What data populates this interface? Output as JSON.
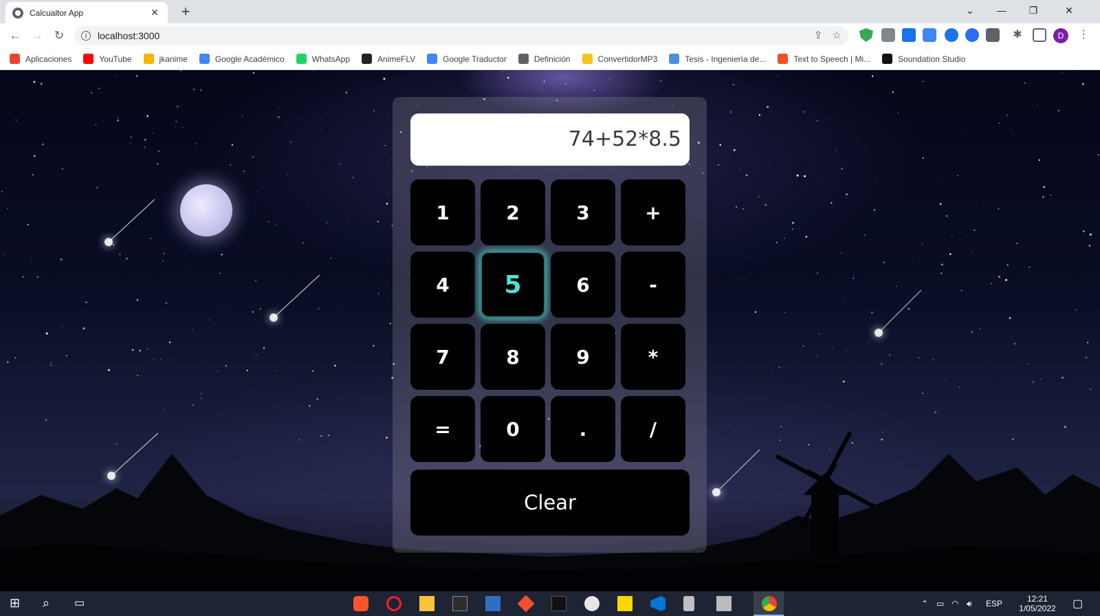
{
  "browser": {
    "tab_title": "Calcualtor App",
    "url": "localhost:3000",
    "profile_initial": "D"
  },
  "bookmarks": [
    {
      "label": "Aplicaciones",
      "icon": "apps-grid-icon",
      "color": "#ea4335"
    },
    {
      "label": "YouTube",
      "icon": "youtube-icon",
      "color": "#ff0000"
    },
    {
      "label": "jkanime",
      "icon": "jkanime-icon",
      "color": "#f5b400"
    },
    {
      "label": "Google Académico",
      "icon": "scholar-icon",
      "color": "#4285f4"
    },
    {
      "label": "WhatsApp",
      "icon": "whatsapp-icon",
      "color": "#25d366"
    },
    {
      "label": "AnimeFLV",
      "icon": "animeflv-icon",
      "color": "#222222"
    },
    {
      "label": "Google Traductor",
      "icon": "translate-icon",
      "color": "#4285f4"
    },
    {
      "label": "Definición",
      "icon": "definition-icon",
      "color": "#5f6368"
    },
    {
      "label": "ConvertidorMP3",
      "icon": "mp3-icon",
      "color": "#f5c518"
    },
    {
      "label": "Tesis - Ingeniería de...",
      "icon": "drive-icon",
      "color": "#4a90d9"
    },
    {
      "label": "Text to Speech | Mi...",
      "icon": "microsoft-icon",
      "color": "#f25022"
    },
    {
      "label": "Soundation Studio",
      "icon": "soundation-icon",
      "color": "#111111"
    }
  ],
  "calculator": {
    "display": "74+52*8.5",
    "keys": [
      "1",
      "2",
      "3",
      "+",
      "4",
      "5",
      "6",
      "-",
      "7",
      "8",
      "9",
      "*",
      "=",
      "0",
      ".",
      "/"
    ],
    "active_key": "5",
    "clear_label": "Clear",
    "accent": "#4fe0d0"
  },
  "taskbar": {
    "language": "ESP",
    "time": "12:21",
    "date": "1/05/2022"
  }
}
